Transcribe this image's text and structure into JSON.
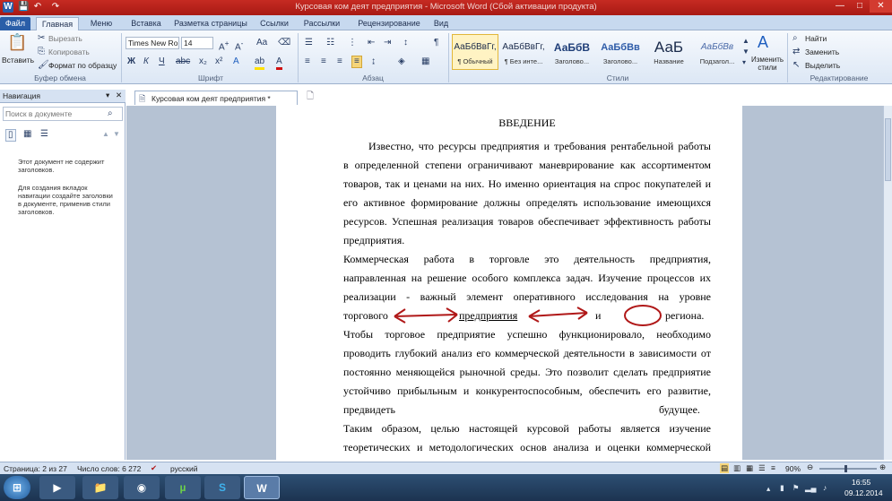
{
  "window": {
    "title": "Курсовая ком деят предприятия - Microsoft Word (Сбой активации продукта)",
    "controls": {
      "minimize": "—",
      "maximize": "□",
      "close": "✕"
    },
    "quick_access": {
      "app_icon": "W",
      "save": "💾",
      "undo": "↶",
      "redo": "↷"
    }
  },
  "ribbon_tabs": [
    "Файл",
    "Главная",
    "Меню",
    "Вставка",
    "Разметка страницы",
    "Ссылки",
    "Рассылки",
    "Рецензирование",
    "Вид"
  ],
  "clipboard": {
    "paste": "Вставить",
    "cut": "Вырезать",
    "copy": "Копировать",
    "format_painter": "Формат по образцу",
    "group": "Буфер обмена"
  },
  "font": {
    "name": "Times New Ro",
    "size": "14",
    "group": "Шрифт"
  },
  "paragraph": {
    "group": "Абзац"
  },
  "styles": {
    "group": "Стили",
    "items": [
      {
        "preview": "АаБбВвГг,",
        "name": "¶ Обычный"
      },
      {
        "preview": "АаБбВвГг,",
        "name": "¶ Без инте..."
      },
      {
        "preview": "АаБбВ",
        "name": "Заголово..."
      },
      {
        "preview": "АаБбВв",
        "name": "Заголово..."
      },
      {
        "preview": "АаБ",
        "name": "Название"
      },
      {
        "preview": "АаБбВв",
        "name": "Подзагол..."
      }
    ],
    "change_styles": "Изменить стили"
  },
  "editing": {
    "group": "Редактирование",
    "find": "Найти",
    "replace": "Заменить",
    "select": "Выделить"
  },
  "navigation": {
    "title": "Навигация",
    "search_placeholder": "Поиск в документе",
    "message1": "Этот документ не содержит заголовков.",
    "message2": "Для создания вкладок навигации создайте заголовки в документе, применив стили заголовков."
  },
  "document_tab": "Курсовая ком деят предприятия *",
  "document": {
    "heading": "ВВЕДЕНИЕ",
    "lines": [
      "Известно, что ресурсы предприятия и требования рентабельной работы",
      "в определенной степени ограничивают маневрирование как ассортиментом",
      "товаров, так и ценами на них. Но именно ориентация на спрос покупателей и",
      "его активное формирование должны определять использование имеющихся",
      "ресурсов. Успешная реализация товаров обеспечивает эффективность работы",
      "предприятия.",
      "Коммерческая работа в торговле это деятельность предприятия,",
      "направленная на решение особого комплекса задач. Изучение процессов их",
      "реализации - важный элемент оперативного исследования на уровне"
    ],
    "annot_line": {
      "w1": "торгового",
      "w2": "предприятия",
      "w3": "и",
      "w4": "региона."
    },
    "lines2": [
      "Чтобы торговое предприятие успешно функционировало, необходимо",
      "проводить глубокий анализ его коммерческой деятельности в зависимости от",
      "постоянно меняющейся рыночной среды. Это позволит сделать предприятие",
      "устойчиво прибыльным и конкурентоспособным, обеспечить его развитие,"
    ],
    "split_line": {
      "left": "предвидеть",
      "right": "будущее."
    },
    "lines3": [
      "Таким образом, целью настоящей курсовой работы является изучение",
      "теоретических и методологических основ анализа и оценки коммерческой"
    ]
  },
  "status": {
    "page": "Страница: 2 из 27",
    "words": "Число слов: 6 272",
    "language": "русский",
    "zoom": "90%"
  },
  "taskbar": {
    "time": "16:55",
    "date": "09.12.2014"
  }
}
